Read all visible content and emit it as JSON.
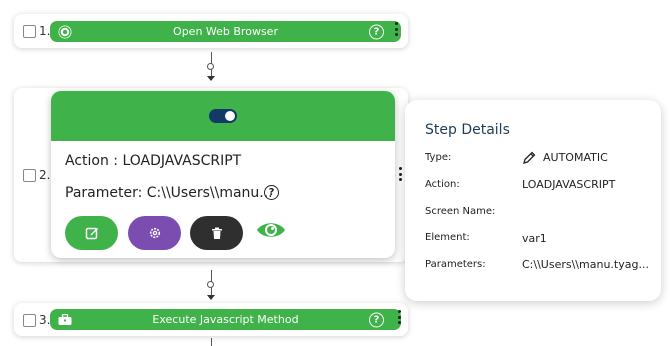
{
  "steps": [
    {
      "number": "1.",
      "label": "Open Web Browser",
      "icon": "chrome-icon"
    },
    {
      "number": "2.",
      "toggle_state": "on"
    },
    {
      "number": "3.",
      "label": "Execute Javascript Method",
      "icon": "toolbox-icon"
    }
  ],
  "help_glyph": "?",
  "expanded": {
    "action_text": "Action : LOADJAVASCRIPT",
    "parameter_text": "Parameter: C:\\\\Users\\\\manu..."
  },
  "details": {
    "title": "Step Details",
    "rows": [
      {
        "label": "Type:",
        "value": "AUTOMATIC"
      },
      {
        "label": "Action:",
        "value": "LOADJAVASCRIPT"
      },
      {
        "label": "Screen Name:",
        "value": ""
      },
      {
        "label": "Element:",
        "value": "var1"
      },
      {
        "label": "Parameters:",
        "value": "C:\\\\Users\\\\manu.tyag..."
      }
    ]
  },
  "colors": {
    "green": "#3fb34a",
    "purple": "#7b4db0",
    "dark": "#2f2f2f",
    "navy": "#123a66",
    "title": "#1c3d5a"
  }
}
